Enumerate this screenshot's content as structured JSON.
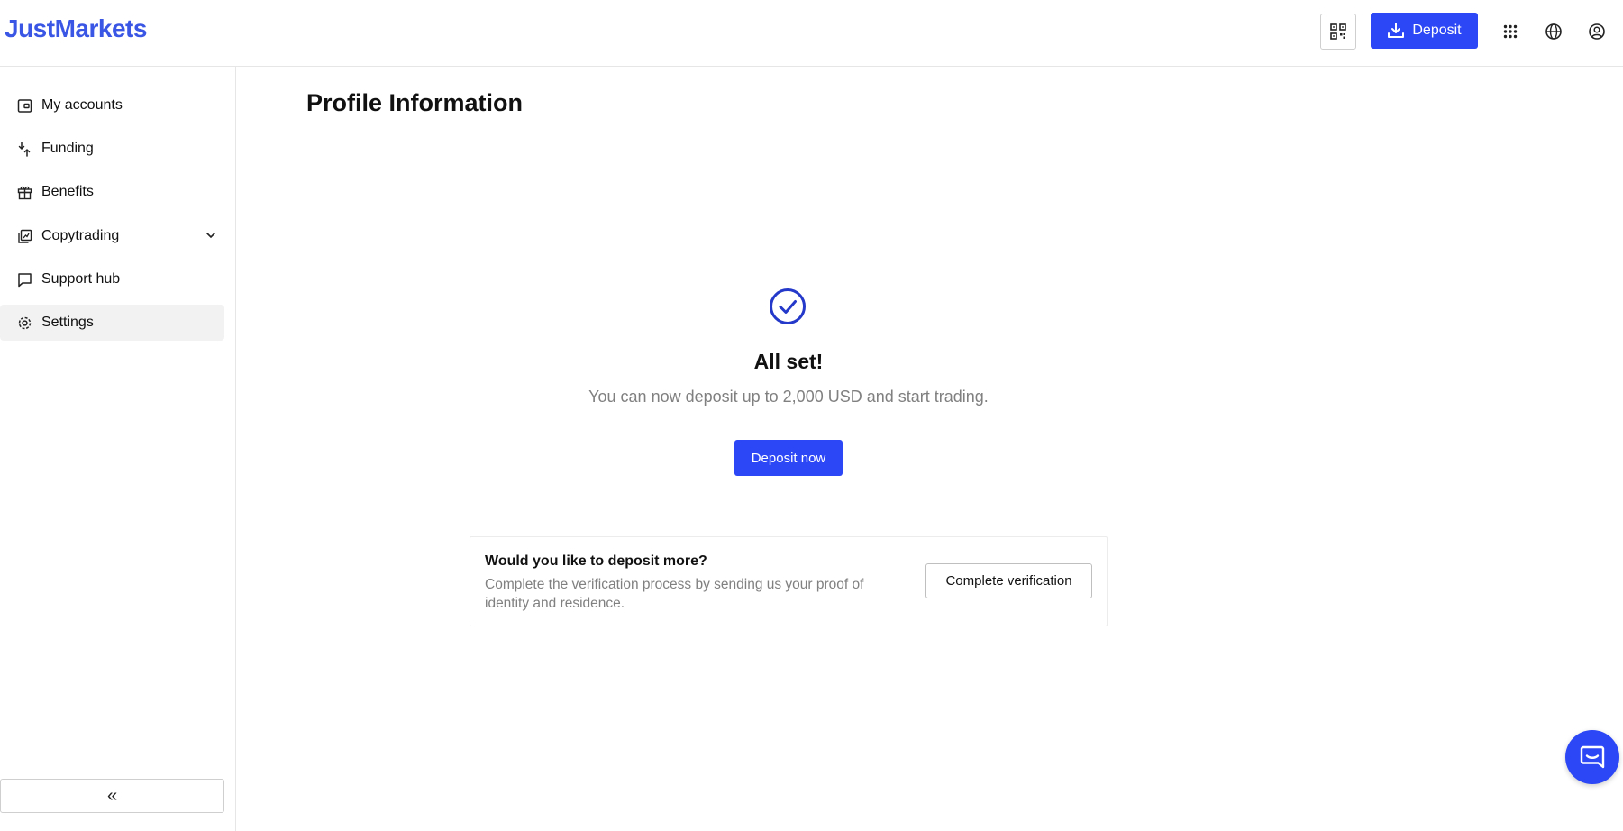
{
  "brand": {
    "name": "JustMarkets",
    "accent": "#2c47f5",
    "logo_color": "#3a56e4"
  },
  "header": {
    "deposit_label": "Deposit",
    "icons": [
      "qr-code-icon",
      "download-icon",
      "apps-grid-icon",
      "globe-icon",
      "user-circle-icon"
    ]
  },
  "sidebar": {
    "items": [
      {
        "label": "My accounts",
        "icon": "wallet-icon"
      },
      {
        "label": "Funding",
        "icon": "funding-arrows-icon"
      },
      {
        "label": "Benefits",
        "icon": "gift-icon"
      },
      {
        "label": "Copytrading",
        "icon": "copytrading-icon",
        "has_submenu": true
      },
      {
        "label": "Support hub",
        "icon": "chat-bubble-icon"
      },
      {
        "label": "Settings",
        "icon": "gear-icon",
        "active": true
      }
    ],
    "collapse_label": "«"
  },
  "main": {
    "title": "Profile Information",
    "success": {
      "heading": "All set!",
      "message": "You can now deposit up to 2,000 USD and start trading.",
      "cta_label": "Deposit now"
    },
    "verify_card": {
      "title": "Would you like to deposit more?",
      "text": "Complete the verification process by sending us your proof of identity and residence.",
      "button_label": "Complete verification"
    }
  }
}
